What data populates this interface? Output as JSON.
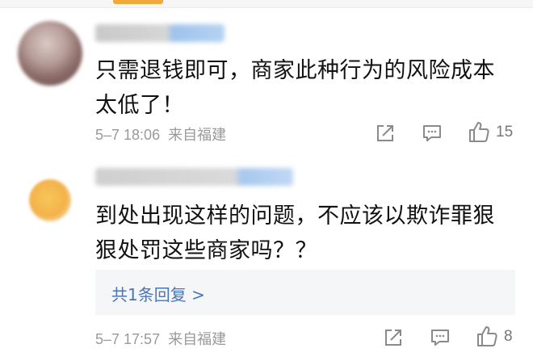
{
  "comments": [
    {
      "text": "只需退钱即可，商家此种行为的风险成本太低了！",
      "meta": "5–7 18:06  来自福建",
      "likes": "15"
    },
    {
      "text": "到处出现这样的问题，不应该以欺诈罪狠狠处罚这些商家吗？？",
      "reply_link": "共1条回复 >",
      "meta": "5–7 17:57  来自福建",
      "likes": "8"
    }
  ],
  "icons": [
    "share-icon",
    "comment-icon",
    "thumbs-up-icon"
  ],
  "colors": {
    "link": "#4a75b6",
    "meta": "#9a9a9a",
    "text": "#111111",
    "reply_bg": "#f5f6f8",
    "accent": "#f0a93a"
  }
}
